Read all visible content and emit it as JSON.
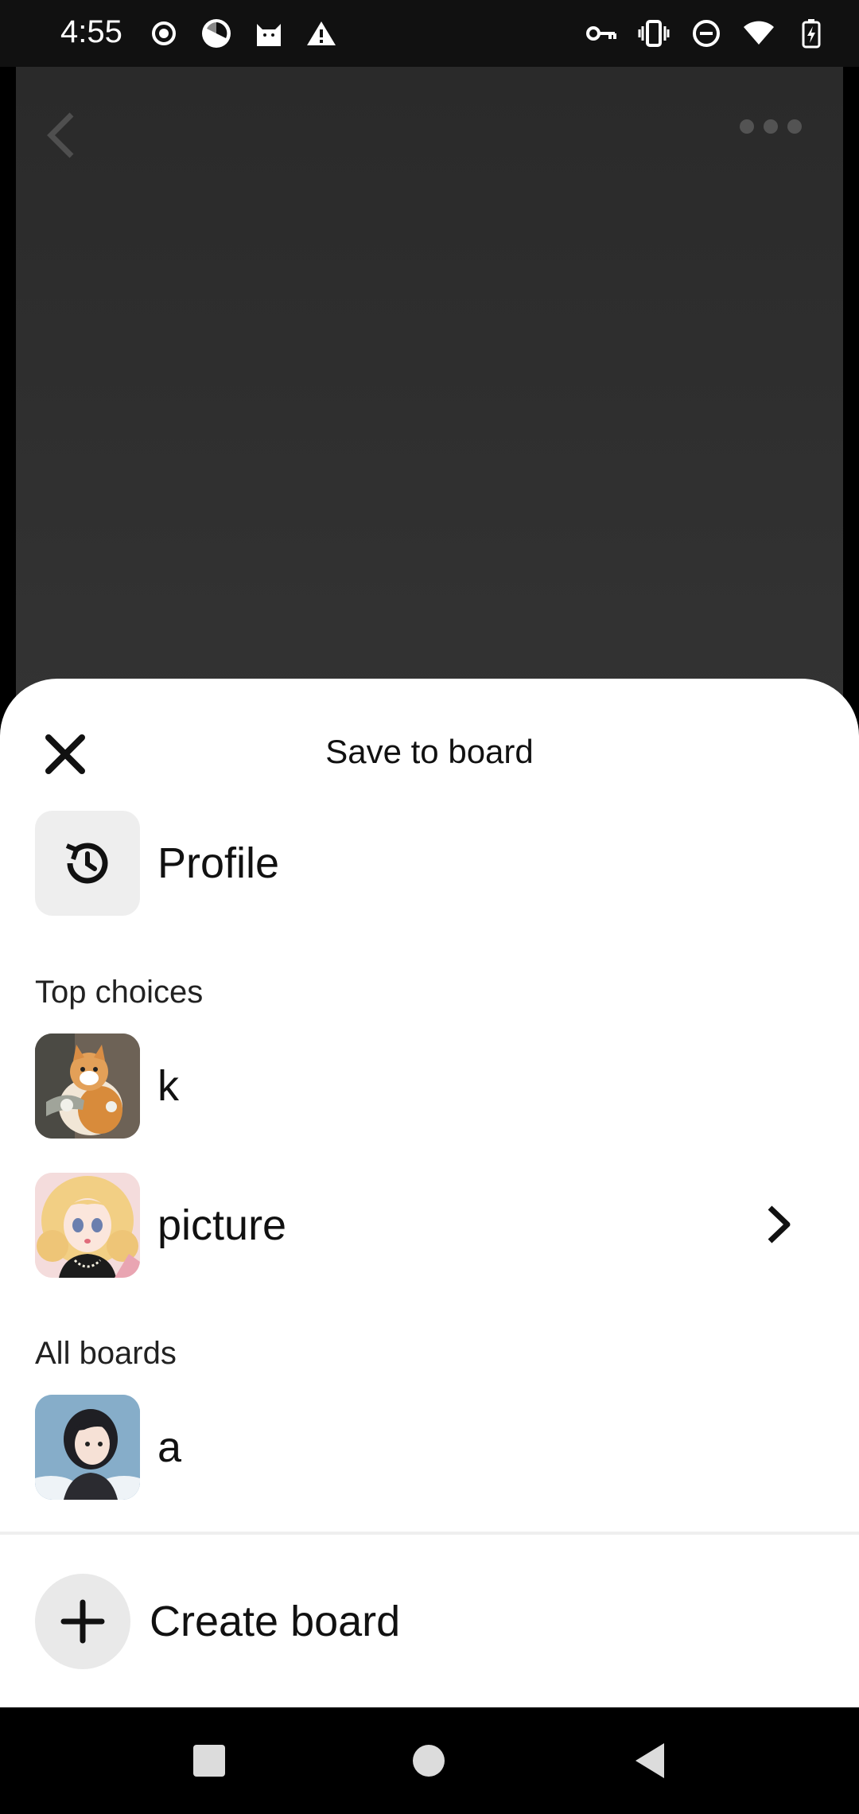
{
  "status_bar": {
    "time": "4:55",
    "left_icons": [
      "record-icon",
      "camera-shutter-icon",
      "cat-icon",
      "warning-icon"
    ],
    "right_icons": [
      "vpn-key-icon",
      "vibrate-icon",
      "do-not-disturb-icon",
      "wifi-icon",
      "battery-charging-icon"
    ]
  },
  "sheet": {
    "title": "Save to board",
    "profile_label": "Profile",
    "top_choices_heading": "Top choices",
    "top_choices": [
      {
        "label": "k"
      },
      {
        "label": "picture"
      }
    ],
    "all_boards_heading": "All boards",
    "all_boards": [
      {
        "label": "a"
      }
    ],
    "create_board_label": "Create board"
  },
  "colors": {
    "sheet_bg": "#ffffff",
    "text": "#111111",
    "profile_tile": "#eeeeee",
    "plus_circle": "#e9e9e9",
    "scrim": "#2d2d2d"
  }
}
